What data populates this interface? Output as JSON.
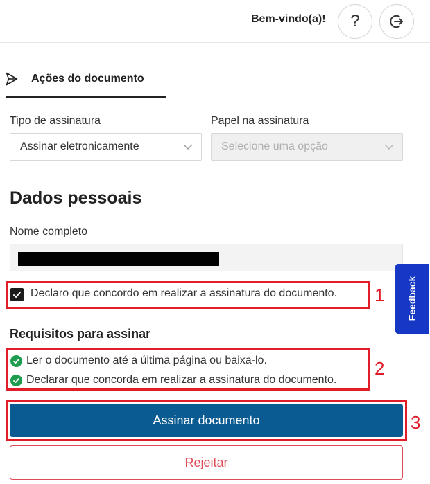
{
  "header": {
    "welcome": "Bem-vindo(a)!",
    "help_icon": "question-icon",
    "logout_icon": "logout-icon"
  },
  "tab": {
    "label": "Ações do documento",
    "icon": "send-icon"
  },
  "form": {
    "signature_type": {
      "label": "Tipo de assinatura",
      "value": "Assinar eletronicamente"
    },
    "signature_role": {
      "label": "Papel na assinatura",
      "placeholder": "Selecione uma opção"
    }
  },
  "personal": {
    "title": "Dados pessoais",
    "name_label": "Nome completo"
  },
  "consent": {
    "text": "Declaro que concordo em realizar a assinatura do documento.",
    "checked": true
  },
  "requirements": {
    "title": "Requisitos para assinar",
    "items": [
      "Ler o documento até a última página ou baixa-lo.",
      "Declarar que concorda em realizar a assinatura do documento."
    ]
  },
  "actions": {
    "sign": "Assinar documento",
    "reject": "Rejeitar"
  },
  "feedback": {
    "label": "Feedback"
  },
  "annotations": {
    "n1": "1",
    "n2": "2",
    "n3": "3",
    "color": "#e11d2a"
  },
  "colors": {
    "primary": "#0a5b92",
    "reject": "#e04a56",
    "success": "#1f9d4e",
    "feedback": "#1638c4"
  }
}
